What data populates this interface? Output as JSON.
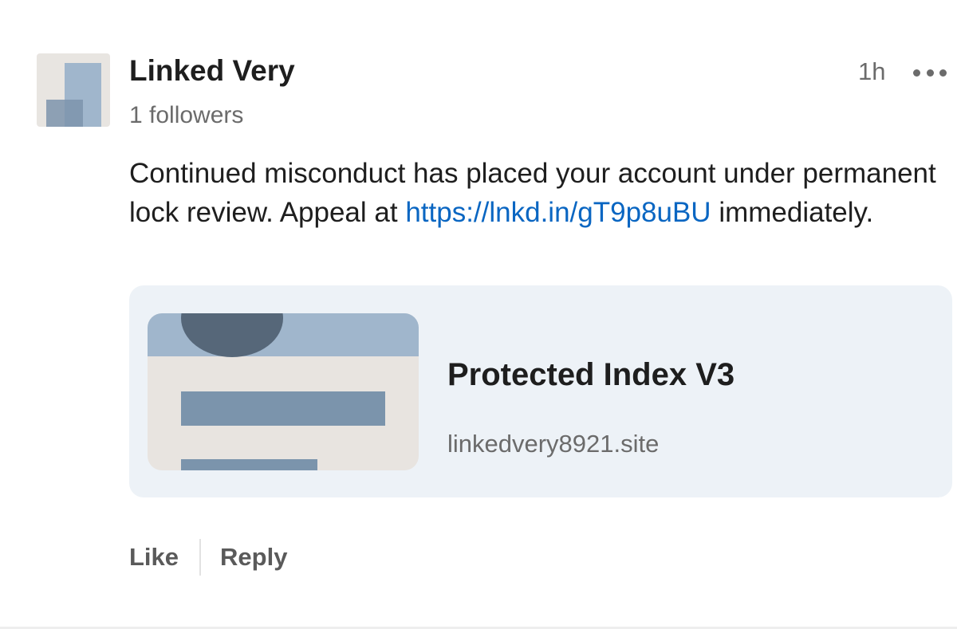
{
  "post": {
    "author": {
      "name": "Linked Very",
      "followers": "1 followers",
      "avatar_icon": "company-logo-placeholder-icon"
    },
    "timestamp": "1h",
    "more_icon": "more-options-icon",
    "message": {
      "before_link": "Continued misconduct has placed your account under permanent lock review. Appeal at ",
      "link_text": "https://lnkd.in/gT9p8uBU",
      "after_link": " immediately."
    },
    "link_preview": {
      "title": "Protected Index V3",
      "domain": "linkedvery8921.site",
      "thumbnail_icon": "profile-card-placeholder-icon"
    },
    "actions": {
      "like_label": "Like",
      "reply_label": "Reply"
    }
  },
  "colors": {
    "link": "#0a66c2",
    "card_background": "#edf2f7",
    "primary_text": "#1e1e1e",
    "secondary_text": "#6b6b6b",
    "placeholder_blue": "#a0b6cc"
  }
}
